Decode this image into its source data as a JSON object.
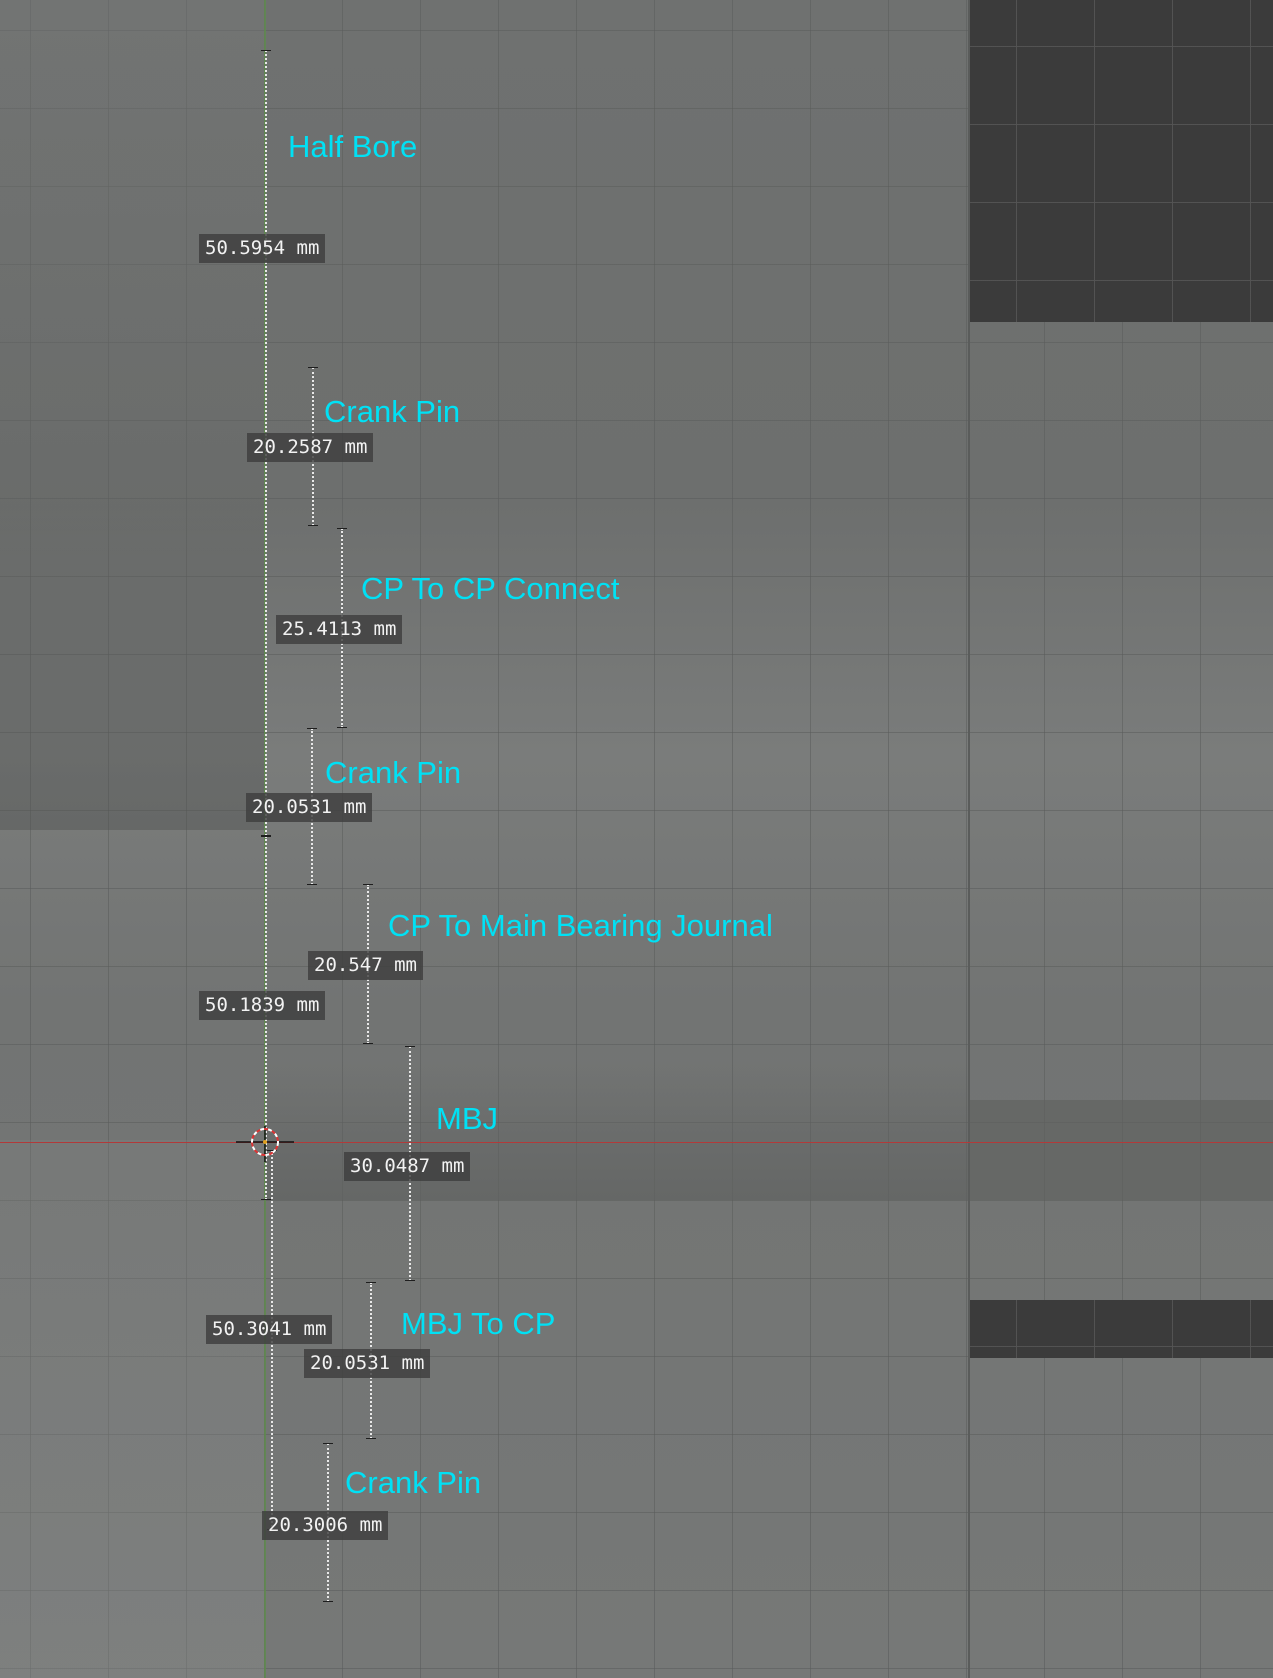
{
  "viewport": {
    "background_color": "#727473",
    "grid_color": "#5a5c5b",
    "dark_panel_color": "#3b3b3b",
    "label_color": "#00e1f5",
    "value_box_color": "#3e3e3e",
    "y_axis_color": "#5f8a4f",
    "x_axis_color": "#b23a3a"
  },
  "annotations": [
    {
      "label": "Half Bore",
      "value": "50.5954 mm"
    },
    {
      "label": "Crank Pin",
      "value": "20.2587 mm"
    },
    {
      "label": "CP To CP Connect",
      "value": "25.4113 mm"
    },
    {
      "label": "Crank Pin",
      "value": "20.0531 mm"
    },
    {
      "label": "CP To Main Bearing Journal",
      "value": "20.547 mm"
    },
    {
      "label": "MBJ",
      "value": "30.0487 mm"
    },
    {
      "label": "MBJ To CP",
      "value": "20.0531 mm"
    },
    {
      "label": "Crank Pin",
      "value": "20.3006 mm"
    }
  ],
  "extra_values": [
    "50.1839 mm",
    "50.3041 mm"
  ],
  "icons": {
    "cursor": "3d-cursor-icon"
  }
}
